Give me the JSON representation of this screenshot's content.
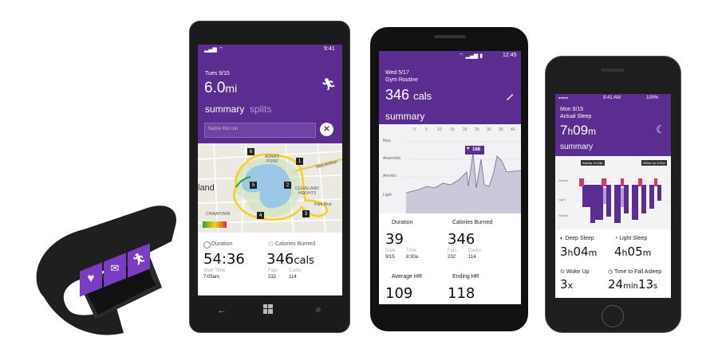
{
  "colors": {
    "brand_purple": "#5c2d91",
    "band_accent": "#7a3cc2",
    "route_yellow": "#f4d21f",
    "hr_line": "#6c6c8c"
  },
  "band": {
    "icons": [
      "heart-icon",
      "mail-icon",
      "run-icon"
    ]
  },
  "winphone": {
    "status": {
      "time": "9:41"
    },
    "date": "Tues 9/15",
    "distance_value": "6.0",
    "distance_unit": "mi",
    "tab_summary": "summary",
    "tab_splits": "splits",
    "name_placeholder": "Name this run",
    "map": {
      "labels": [
        "MacArthur",
        "ADAMS",
        "POINT",
        "CLEVELAND",
        "HEIGHTS",
        "Park Blvd",
        "CHINATOWN",
        "land"
      ]
    },
    "markers": [
      "1",
      "2",
      "3",
      "4",
      "5",
      "6"
    ],
    "duration_label": "Duration",
    "duration_value": "54:36",
    "start_label": "Start Time",
    "start_value": "7:05am",
    "calories_label": "Calories Burned",
    "calories_value": "346",
    "calories_unit": "cals",
    "fats_label": "Fats",
    "fats_value": "232",
    "carbs_label": "Carbs",
    "carbs_value": "114"
  },
  "android": {
    "status": {
      "time": "12:45"
    },
    "date": "Wed 5/17",
    "activity": "Gym Routine",
    "cal_value": "346",
    "cal_unit": "cals",
    "summary": "summary",
    "chart": {
      "x_ticks": [
        "0",
        "5",
        "10",
        "15",
        "20",
        "25",
        "30",
        "35",
        "40"
      ],
      "zones": [
        "Max.",
        "Anaerobic",
        "Aerobic",
        "Light"
      ],
      "peak_label": "168"
    },
    "duration_label": "Duration",
    "duration_value": "39",
    "cal_label": "Calories Burned",
    "cal_big": "346",
    "date_label": "Date",
    "date_value": "9/15",
    "time_label": "Time",
    "time_value": "8:30a",
    "fats_label": "Fats",
    "fats_value": "232",
    "carbs_label": "Carbs",
    "carbs_value": "114",
    "avg_hr_label": "Average HR",
    "avg_hr_value": "109",
    "end_hr_label": "Ending HR",
    "end_hr_value": "118"
  },
  "iphone": {
    "status": {
      "carrier": "●●●●●",
      "time": "9:41 AM",
      "battery": "100%"
    },
    "date": "Mon 9/15",
    "activity": "Actual Sleep",
    "hours_value": "7",
    "hours_unit": "h",
    "minutes_value": "09",
    "minutes_unit": "m",
    "summary": "summary",
    "chart": {
      "badge_left": "Asleep 10:43p",
      "badge_right": "Woke Up 6:51a",
      "zones": [
        "Awake",
        "Light",
        "Restful"
      ]
    },
    "deep_label": "Deep Sleep",
    "deep_h": "3",
    "deep_m": "04",
    "light_label": "Light Sleep",
    "light_h": "4",
    "light_m": "05",
    "wokeup_label": "Woke Up",
    "wokeup_value": "3",
    "wokeup_unit": "x",
    "fall_label": "Time to Fall Asleep",
    "fall_min": "24",
    "fall_sec": "13",
    "h": "h",
    "m": "m",
    "min": "min",
    "s": "s"
  }
}
